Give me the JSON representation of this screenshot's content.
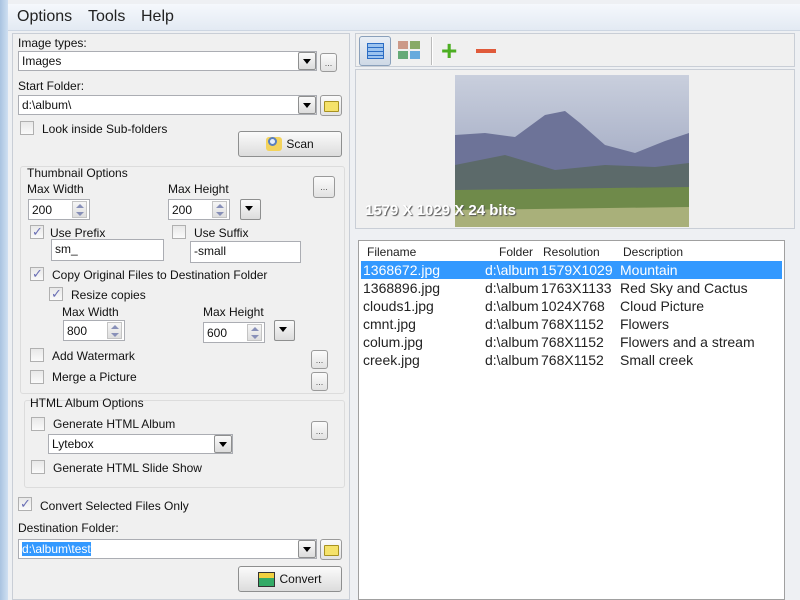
{
  "menu": [
    "Options",
    "Tools",
    "Help"
  ],
  "image_types": {
    "label": "Image types:",
    "value": "Images",
    "more": "..."
  },
  "start_folder": {
    "label": "Start Folder:",
    "value": "d:\\album\\"
  },
  "look_inside": {
    "label": "Look inside Sub-folders",
    "checked": false
  },
  "scan_label": "Scan",
  "thumb": {
    "title": "Thumbnail Options",
    "max_width_label": "Max Width",
    "max_width": "200",
    "max_height_label": "Max Height",
    "max_height": "200",
    "more": "...",
    "use_prefix": {
      "label": "Use Prefix",
      "checked": true,
      "value": "sm_"
    },
    "use_suffix": {
      "label": "Use Suffix",
      "checked": false,
      "value": "-small"
    }
  },
  "copy_original": {
    "label": "Copy Original Files to Destination Folder",
    "checked": true
  },
  "resize": {
    "label": "Resize copies",
    "checked": true,
    "max_width_label": "Max Width",
    "max_width": "800",
    "max_height_label": "Max Height",
    "max_height": "600"
  },
  "watermark": {
    "label": "Add Watermark",
    "checked": false,
    "more": "..."
  },
  "merge": {
    "label": "Merge a Picture",
    "checked": false,
    "more": "..."
  },
  "html": {
    "title": "HTML Album Options",
    "album_label": "Generate HTML Album",
    "album_checked": false,
    "template": "Lytebox",
    "more": "...",
    "slideshow_label": "Generate HTML Slide Show",
    "slideshow_checked": false
  },
  "convert_selected": {
    "label": "Convert Selected Files Only",
    "checked": true
  },
  "dest": {
    "label": "Destination Folder:",
    "value": "d:\\album\\test"
  },
  "convert_label": "Convert",
  "preview": {
    "info": "1579 X 1029 X 24 bits"
  },
  "files": {
    "headers": [
      "Filename",
      "Folder",
      "Resolution",
      "Description"
    ],
    "rows": [
      [
        "1368672.jpg",
        "d:\\album",
        "1579X1029",
        "Mountain"
      ],
      [
        "1368896.jpg",
        "d:\\album",
        "1763X1133",
        "Red Sky and Cactus"
      ],
      [
        "clouds1.jpg",
        "d:\\album",
        "1024X768",
        "Cloud Picture"
      ],
      [
        "cmnt.jpg",
        "d:\\album",
        "768X1152",
        "Flowers"
      ],
      [
        "colum.jpg",
        "d:\\album",
        "768X1152",
        "Flowers and a stream"
      ],
      [
        "creek.jpg",
        "d:\\album",
        "768X1152",
        "Small creek"
      ]
    ],
    "selected": 0
  },
  "colors": {
    "selection": "#3399ff",
    "add": "#4cae22",
    "remove": "#e05a3a"
  }
}
